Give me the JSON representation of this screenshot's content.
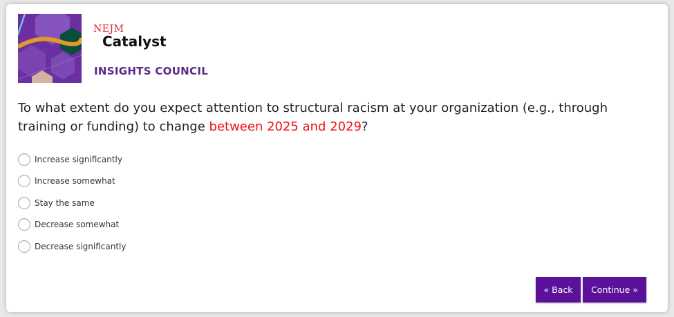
{
  "brand": {
    "publisher": "NEJM",
    "product": "Catalyst",
    "council": "INSIGHTS COUNCIL"
  },
  "question": {
    "text_before": "To what extent do you expect attention to structural racism at your organization (e.g., through training or funding) to change ",
    "highlight": "between 2025 and 2029",
    "text_after": "?"
  },
  "options": [
    "Increase significantly",
    "Increase somewhat",
    "Stay the same",
    "Decrease somewhat",
    "Decrease significantly"
  ],
  "buttons": {
    "back": "« Back",
    "continue": "Continue »"
  },
  "colors": {
    "brand_purple": "#5b119a",
    "highlight_red": "#ee1111",
    "council_purple": "#5a2a86",
    "nejm_red": "#d9262f"
  },
  "icons": {
    "logo": "hexagon-pattern-logo",
    "radio": "radio-empty-icon"
  }
}
